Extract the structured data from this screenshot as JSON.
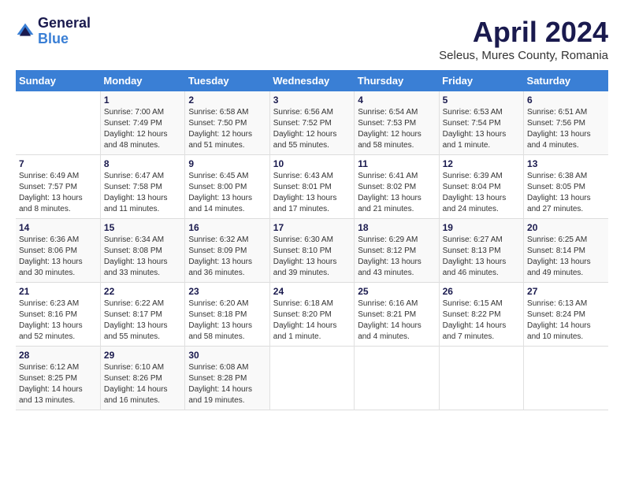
{
  "header": {
    "logo_general": "General",
    "logo_blue": "Blue",
    "month_title": "April 2024",
    "subtitle": "Seleus, Mures County, Romania"
  },
  "days_of_week": [
    "Sunday",
    "Monday",
    "Tuesday",
    "Wednesday",
    "Thursday",
    "Friday",
    "Saturday"
  ],
  "weeks": [
    [
      {
        "day": "",
        "sunrise": "",
        "sunset": "",
        "daylight": ""
      },
      {
        "day": "1",
        "sunrise": "Sunrise: 7:00 AM",
        "sunset": "Sunset: 7:49 PM",
        "daylight": "Daylight: 12 hours and 48 minutes."
      },
      {
        "day": "2",
        "sunrise": "Sunrise: 6:58 AM",
        "sunset": "Sunset: 7:50 PM",
        "daylight": "Daylight: 12 hours and 51 minutes."
      },
      {
        "day": "3",
        "sunrise": "Sunrise: 6:56 AM",
        "sunset": "Sunset: 7:52 PM",
        "daylight": "Daylight: 12 hours and 55 minutes."
      },
      {
        "day": "4",
        "sunrise": "Sunrise: 6:54 AM",
        "sunset": "Sunset: 7:53 PM",
        "daylight": "Daylight: 12 hours and 58 minutes."
      },
      {
        "day": "5",
        "sunrise": "Sunrise: 6:53 AM",
        "sunset": "Sunset: 7:54 PM",
        "daylight": "Daylight: 13 hours and 1 minute."
      },
      {
        "day": "6",
        "sunrise": "Sunrise: 6:51 AM",
        "sunset": "Sunset: 7:56 PM",
        "daylight": "Daylight: 13 hours and 4 minutes."
      }
    ],
    [
      {
        "day": "7",
        "sunrise": "Sunrise: 6:49 AM",
        "sunset": "Sunset: 7:57 PM",
        "daylight": "Daylight: 13 hours and 8 minutes."
      },
      {
        "day": "8",
        "sunrise": "Sunrise: 6:47 AM",
        "sunset": "Sunset: 7:58 PM",
        "daylight": "Daylight: 13 hours and 11 minutes."
      },
      {
        "day": "9",
        "sunrise": "Sunrise: 6:45 AM",
        "sunset": "Sunset: 8:00 PM",
        "daylight": "Daylight: 13 hours and 14 minutes."
      },
      {
        "day": "10",
        "sunrise": "Sunrise: 6:43 AM",
        "sunset": "Sunset: 8:01 PM",
        "daylight": "Daylight: 13 hours and 17 minutes."
      },
      {
        "day": "11",
        "sunrise": "Sunrise: 6:41 AM",
        "sunset": "Sunset: 8:02 PM",
        "daylight": "Daylight: 13 hours and 21 minutes."
      },
      {
        "day": "12",
        "sunrise": "Sunrise: 6:39 AM",
        "sunset": "Sunset: 8:04 PM",
        "daylight": "Daylight: 13 hours and 24 minutes."
      },
      {
        "day": "13",
        "sunrise": "Sunrise: 6:38 AM",
        "sunset": "Sunset: 8:05 PM",
        "daylight": "Daylight: 13 hours and 27 minutes."
      }
    ],
    [
      {
        "day": "14",
        "sunrise": "Sunrise: 6:36 AM",
        "sunset": "Sunset: 8:06 PM",
        "daylight": "Daylight: 13 hours and 30 minutes."
      },
      {
        "day": "15",
        "sunrise": "Sunrise: 6:34 AM",
        "sunset": "Sunset: 8:08 PM",
        "daylight": "Daylight: 13 hours and 33 minutes."
      },
      {
        "day": "16",
        "sunrise": "Sunrise: 6:32 AM",
        "sunset": "Sunset: 8:09 PM",
        "daylight": "Daylight: 13 hours and 36 minutes."
      },
      {
        "day": "17",
        "sunrise": "Sunrise: 6:30 AM",
        "sunset": "Sunset: 8:10 PM",
        "daylight": "Daylight: 13 hours and 39 minutes."
      },
      {
        "day": "18",
        "sunrise": "Sunrise: 6:29 AM",
        "sunset": "Sunset: 8:12 PM",
        "daylight": "Daylight: 13 hours and 43 minutes."
      },
      {
        "day": "19",
        "sunrise": "Sunrise: 6:27 AM",
        "sunset": "Sunset: 8:13 PM",
        "daylight": "Daylight: 13 hours and 46 minutes."
      },
      {
        "day": "20",
        "sunrise": "Sunrise: 6:25 AM",
        "sunset": "Sunset: 8:14 PM",
        "daylight": "Daylight: 13 hours and 49 minutes."
      }
    ],
    [
      {
        "day": "21",
        "sunrise": "Sunrise: 6:23 AM",
        "sunset": "Sunset: 8:16 PM",
        "daylight": "Daylight: 13 hours and 52 minutes."
      },
      {
        "day": "22",
        "sunrise": "Sunrise: 6:22 AM",
        "sunset": "Sunset: 8:17 PM",
        "daylight": "Daylight: 13 hours and 55 minutes."
      },
      {
        "day": "23",
        "sunrise": "Sunrise: 6:20 AM",
        "sunset": "Sunset: 8:18 PM",
        "daylight": "Daylight: 13 hours and 58 minutes."
      },
      {
        "day": "24",
        "sunrise": "Sunrise: 6:18 AM",
        "sunset": "Sunset: 8:20 PM",
        "daylight": "Daylight: 14 hours and 1 minute."
      },
      {
        "day": "25",
        "sunrise": "Sunrise: 6:16 AM",
        "sunset": "Sunset: 8:21 PM",
        "daylight": "Daylight: 14 hours and 4 minutes."
      },
      {
        "day": "26",
        "sunrise": "Sunrise: 6:15 AM",
        "sunset": "Sunset: 8:22 PM",
        "daylight": "Daylight: 14 hours and 7 minutes."
      },
      {
        "day": "27",
        "sunrise": "Sunrise: 6:13 AM",
        "sunset": "Sunset: 8:24 PM",
        "daylight": "Daylight: 14 hours and 10 minutes."
      }
    ],
    [
      {
        "day": "28",
        "sunrise": "Sunrise: 6:12 AM",
        "sunset": "Sunset: 8:25 PM",
        "daylight": "Daylight: 14 hours and 13 minutes."
      },
      {
        "day": "29",
        "sunrise": "Sunrise: 6:10 AM",
        "sunset": "Sunset: 8:26 PM",
        "daylight": "Daylight: 14 hours and 16 minutes."
      },
      {
        "day": "30",
        "sunrise": "Sunrise: 6:08 AM",
        "sunset": "Sunset: 8:28 PM",
        "daylight": "Daylight: 14 hours and 19 minutes."
      },
      {
        "day": "",
        "sunrise": "",
        "sunset": "",
        "daylight": ""
      },
      {
        "day": "",
        "sunrise": "",
        "sunset": "",
        "daylight": ""
      },
      {
        "day": "",
        "sunrise": "",
        "sunset": "",
        "daylight": ""
      },
      {
        "day": "",
        "sunrise": "",
        "sunset": "",
        "daylight": ""
      }
    ]
  ]
}
